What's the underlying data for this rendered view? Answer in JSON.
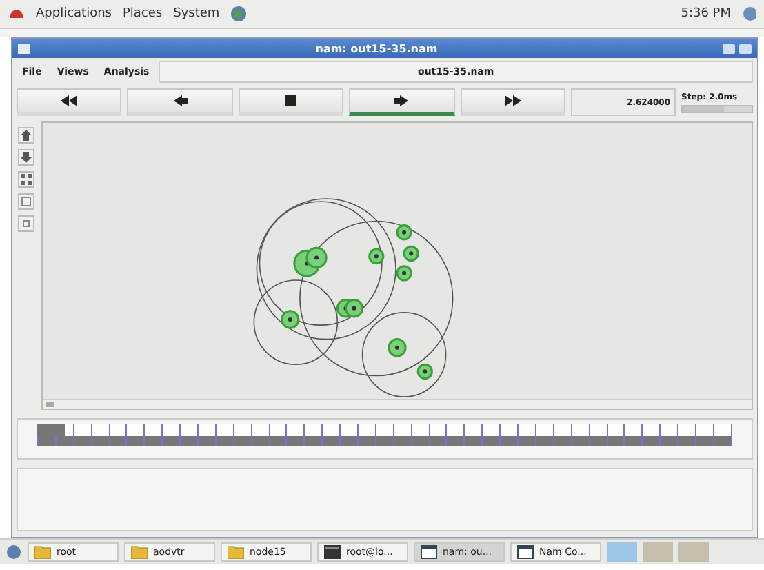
{
  "top_panel": {
    "menus": [
      "Applications",
      "Places",
      "System"
    ],
    "clock": "5:36 PM"
  },
  "window": {
    "title": "nam: out15-35.nam"
  },
  "menubar": {
    "items": [
      "File",
      "Views",
      "Analysis"
    ],
    "file_label": "out15-35.nam"
  },
  "controls": [
    {
      "kind": "rewind",
      "selected": false
    },
    {
      "kind": "back",
      "selected": false
    },
    {
      "kind": "stop",
      "selected": false
    },
    {
      "kind": "play",
      "selected": true
    },
    {
      "kind": "forward",
      "selected": false
    }
  ],
  "time": "2.624000",
  "step": {
    "label": "Step: 2.0ms",
    "level": 0.6
  },
  "taskbar": [
    {
      "label": "root",
      "kind": "folder"
    },
    {
      "label": "aodvtr",
      "kind": "folder"
    },
    {
      "label": "node15",
      "kind": "folder"
    },
    {
      "label": "root@lo...",
      "kind": "terminal"
    },
    {
      "label": "nam: ou...",
      "kind": "window",
      "selected": true
    },
    {
      "label": "Nam Co...",
      "kind": "window",
      "selected": false
    }
  ]
}
